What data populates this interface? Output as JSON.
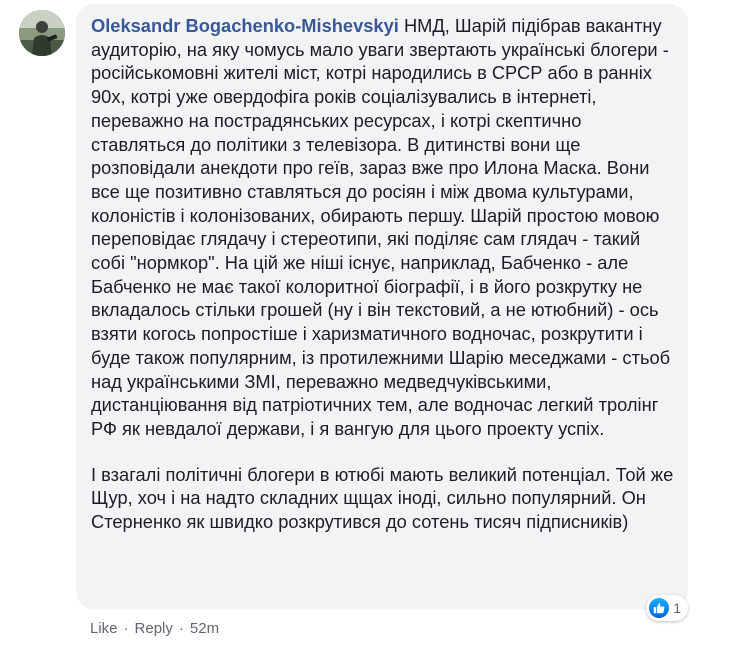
{
  "comment": {
    "author": "Oleksandr Bogachenko-Mishevskyi",
    "paragraphs": [
      "НМД, Шарій підібрав вакантну аудиторію, на яку чомусь мало уваги звертають українські блогери - російськомовні жителі міст, котрі народились в СРСР або в ранніх 90х, котрі уже овердофіга років соціалізувались в інтернеті, переважно на пострадянських ресурсах, і котрі скептично ставляться до політики з телевізора. В дитинстві вони ще розповідали анекдоти про геїв, зараз вже про Илона Маска. Вони все ще позитивно ставляться до росіян і між двома культурами, колоністів і колонізованих, обирають першу. Шарій простою мовою переповідає глядачу і стереотипи, які поділяє сам глядач - такий собі \"нормкор\". На цій же ніші існує, наприклад, Бабченко - але Бабченко не має такої колоритної біографії, і в його розкрутку не вкладалось стільки грошей (ну і він текстовий, а не ютюбний) - ось взяти когось попростіше і харизматичного водночас, розкрутити і буде також популярним, із протилежними Шарію меседжами - стьоб над українськими ЗМІ, переважно медведчуківськими, дистанціювання від патріотичних тем, але водночас легкий тролінг РФ як невдалої держави, і я вангую для цього проекту успіх.",
      "І взагалі політичні блогери в ютюбі мають великий потенціал. Той же Щур, хоч і на надто складних щщах іноді, сильно популярний. Он Стерненко як швидко розкрутився до сотень тисяч підписників)"
    ],
    "reaction_icon": "like-icon",
    "reaction_count": "1",
    "actions": {
      "like": "Like",
      "reply": "Reply",
      "separator": "·",
      "time": "52m"
    }
  },
  "colors": {
    "author": "#385898",
    "text": "#1c1e21",
    "bubble": "#f2f3f5",
    "meta": "#606770",
    "like_blue": "#0866ff"
  }
}
